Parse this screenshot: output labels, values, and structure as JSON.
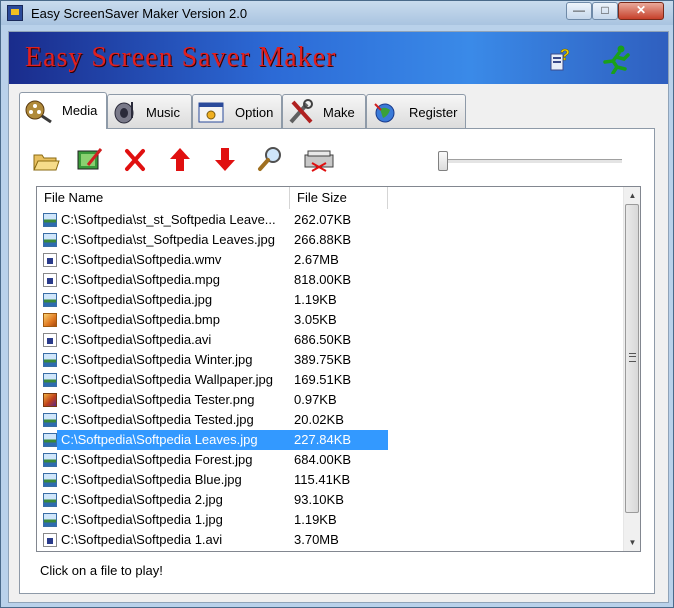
{
  "window": {
    "title": "Easy ScreenSaver Maker Version 2.0",
    "buttons": {
      "minimize": "—",
      "maximize": "□",
      "close": "✕"
    }
  },
  "banner": {
    "title": "Easy Screen Saver Maker",
    "help_icon": "help-icon",
    "run_icon": "running-man-icon"
  },
  "tabs": [
    {
      "label": "Media",
      "icon": "film-reel-icon",
      "active": true
    },
    {
      "label": "Music",
      "icon": "music-icon",
      "active": false
    },
    {
      "label": "Option",
      "icon": "option-window-icon",
      "active": false
    },
    {
      "label": "Make",
      "icon": "tools-icon",
      "active": false
    },
    {
      "label": "Register",
      "icon": "register-globe-icon",
      "active": false
    }
  ],
  "toolbar": {
    "tools": [
      "open-folder-icon",
      "edit-image-icon",
      "delete-icon",
      "move-up-icon",
      "move-down-icon",
      "preview-magnifier-icon",
      "clear-list-icon"
    ],
    "slider_level": 0
  },
  "list": {
    "columns": [
      "File Name",
      "File Size"
    ],
    "rows": [
      {
        "name": "C:\\Softpedia\\st_st_Softpedia Leave...",
        "size": "262.07KB",
        "type": "jpg"
      },
      {
        "name": "C:\\Softpedia\\st_Softpedia Leaves.jpg",
        "size": "266.88KB",
        "type": "jpg"
      },
      {
        "name": "C:\\Softpedia\\Softpedia.wmv",
        "size": "2.67MB",
        "type": "vid"
      },
      {
        "name": "C:\\Softpedia\\Softpedia.mpg",
        "size": "818.00KB",
        "type": "vid"
      },
      {
        "name": "C:\\Softpedia\\Softpedia.jpg",
        "size": "1.19KB",
        "type": "jpg"
      },
      {
        "name": "C:\\Softpedia\\Softpedia.bmp",
        "size": "3.05KB",
        "type": "bmp"
      },
      {
        "name": "C:\\Softpedia\\Softpedia.avi",
        "size": "686.50KB",
        "type": "vid"
      },
      {
        "name": "C:\\Softpedia\\Softpedia Winter.jpg",
        "size": "389.75KB",
        "type": "jpg"
      },
      {
        "name": "C:\\Softpedia\\Softpedia Wallpaper.jpg",
        "size": "169.51KB",
        "type": "jpg"
      },
      {
        "name": "C:\\Softpedia\\Softpedia Tester.png",
        "size": "0.97KB",
        "type": "png"
      },
      {
        "name": "C:\\Softpedia\\Softpedia Tested.jpg",
        "size": "20.02KB",
        "type": "jpg"
      },
      {
        "name": "C:\\Softpedia\\Softpedia Leaves.jpg",
        "size": "227.84KB",
        "type": "jpg",
        "selected": true
      },
      {
        "name": "C:\\Softpedia\\Softpedia Forest.jpg",
        "size": "684.00KB",
        "type": "jpg"
      },
      {
        "name": "C:\\Softpedia\\Softpedia Blue.jpg",
        "size": "115.41KB",
        "type": "jpg"
      },
      {
        "name": "C:\\Softpedia\\Softpedia 2.jpg",
        "size": "93.10KB",
        "type": "jpg"
      },
      {
        "name": "C:\\Softpedia\\Softpedia 1.jpg",
        "size": "1.19KB",
        "type": "jpg"
      },
      {
        "name": "C:\\Softpedia\\Softpedia 1.avi",
        "size": "3.70MB",
        "type": "vid"
      }
    ]
  },
  "status_text": "Click on a file to play!",
  "colors": {
    "selection": "#3399ff",
    "banner_title": "#e02020"
  }
}
